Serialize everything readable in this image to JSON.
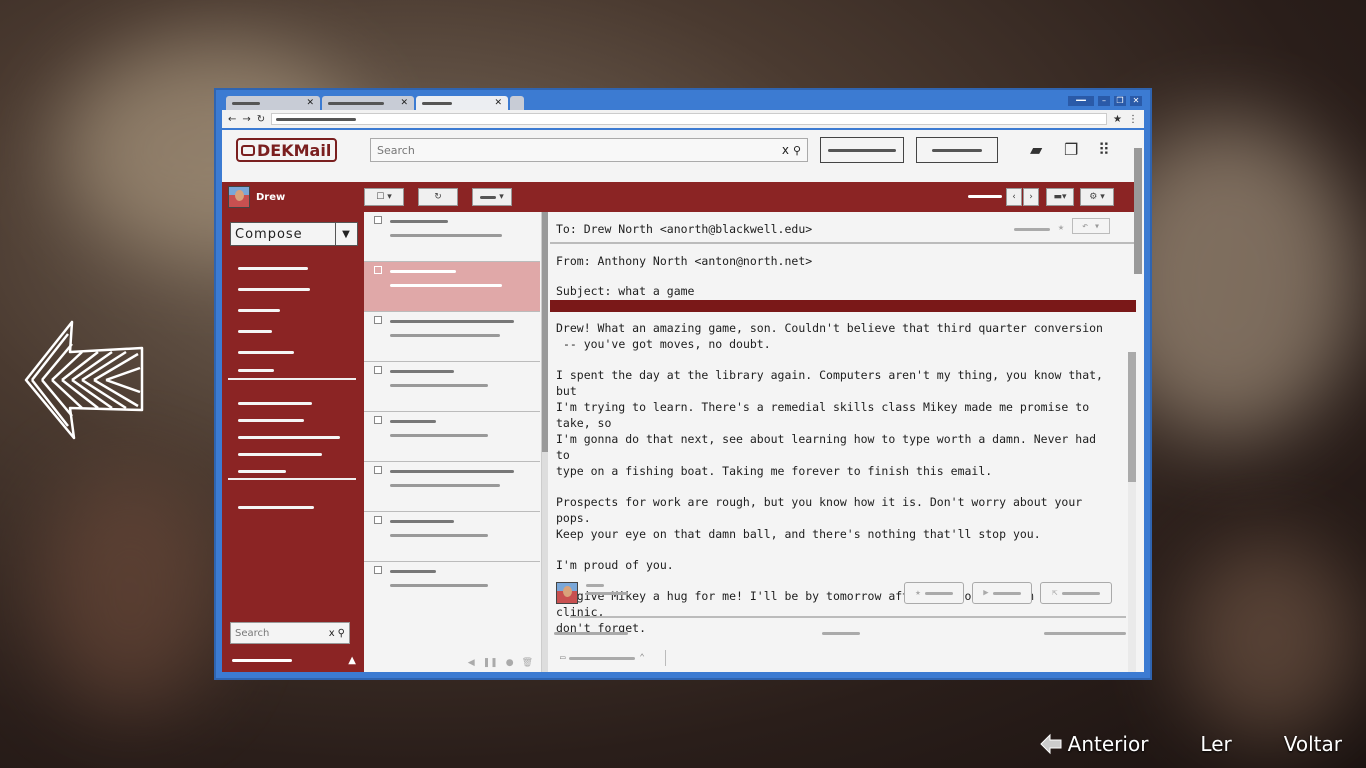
{
  "app": {
    "logo_text": "DEKMail"
  },
  "header": {
    "search_placeholder": "Search",
    "search_clear": "x"
  },
  "user": {
    "name": "Drew"
  },
  "sidebar": {
    "compose_label": "Compose",
    "search_placeholder": "Search",
    "search_clear": "x"
  },
  "email": {
    "to": "To: Drew North <anorth@blackwell.edu>",
    "from": "From: Anthony North <anton@north.net>",
    "subject": "Subject: what a game",
    "paragraphs": [
      "Drew! What an amazing game, son. Couldn't believe that third quarter conversion\n -- you've got moves, no doubt.",
      "I spent the day at the library again. Computers aren't my thing, you know that, but\nI'm trying to learn. There's a remedial skills class Mikey made me promise to take, so\nI'm gonna do that next, see about learning how to type worth a damn. Never had to\ntype on a fishing boat. Taking me forever to finish this email.",
      "Prospects for work are rough, but you know how it is. Don't worry about your pops.\nKeep your eye on that damn ball, and there's nothing that'll stop you.",
      "I'm proud of you.",
      "PS give Mikey a hug for me! I'll be by tomorrow afternoon to take him to the clinic,\ndon't forget."
    ]
  },
  "prompts": {
    "previous": "Anterior",
    "read": "Ler",
    "back": "Voltar"
  },
  "icons": {
    "arrow": "left-arrow-icon",
    "folder": "folder-icon",
    "windows": "windows-icon",
    "apps": "apps-grid-icon"
  },
  "colors": {
    "accent": "#8b2424",
    "selected_row": "#e0a8a8",
    "window_frame": "#3c7bd2"
  }
}
